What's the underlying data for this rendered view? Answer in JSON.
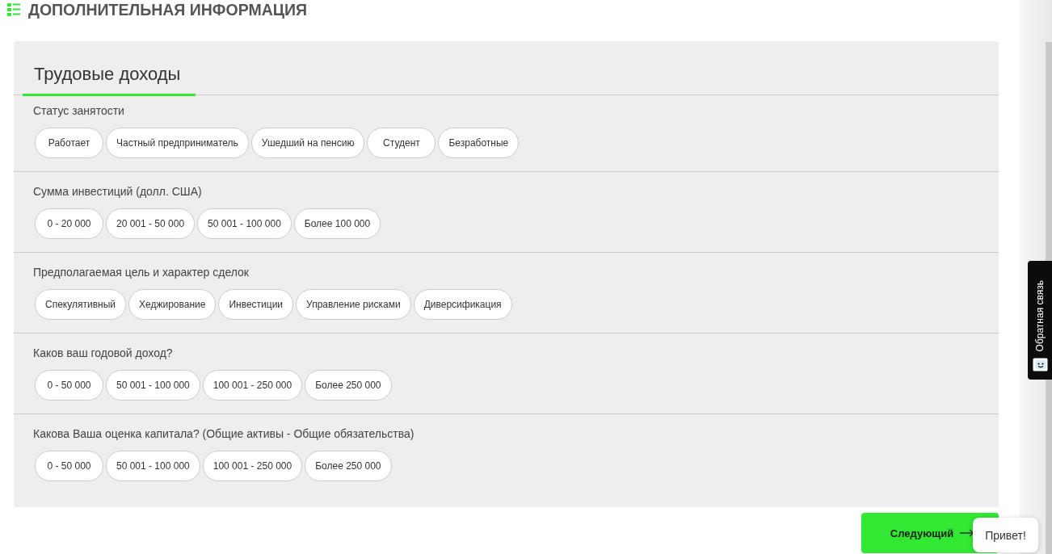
{
  "header": {
    "title": "ДОПОЛНИТЕЛЬНАЯ ИНФОРМАЦИЯ"
  },
  "tabs": [
    {
      "label": "Трудовые доходы",
      "selected": true
    }
  ],
  "questions": [
    {
      "label": "Статус занятости",
      "options": [
        {
          "label": "Работает",
          "selected": false
        },
        {
          "label": "Частный предприниматель",
          "selected": false
        },
        {
          "label": "Ушедший на пенсию",
          "selected": false
        },
        {
          "label": "Студент",
          "selected": false
        },
        {
          "label": "Безработные",
          "selected": false
        }
      ]
    },
    {
      "label": "Сумма инвестиций (долл. США)",
      "options": [
        {
          "label": "0 - 20 000",
          "selected": false
        },
        {
          "label": "20 001 - 50 000",
          "selected": false
        },
        {
          "label": "50 001 - 100 000",
          "selected": false
        },
        {
          "label": "Более 100 000",
          "selected": false
        }
      ]
    },
    {
      "label": "Предполагаемая цель и характер сделок",
      "options": [
        {
          "label": "Спекулятивный",
          "selected": false
        },
        {
          "label": "Хеджирование",
          "selected": false
        },
        {
          "label": "Инвестиции",
          "selected": false
        },
        {
          "label": "Управление рисками",
          "selected": false
        },
        {
          "label": "Диверсификация",
          "selected": false
        }
      ]
    },
    {
      "label": "Каков ваш годовой доход?",
      "options": [
        {
          "label": "0 - 50 000",
          "selected": false
        },
        {
          "label": "50 001 - 100 000",
          "selected": false
        },
        {
          "label": "100 001 - 250 000",
          "selected": false
        },
        {
          "label": "Более 250 000",
          "selected": false
        }
      ]
    },
    {
      "label": "Какова Ваша оценка капитала? (Общие активы - Общие обязательства)",
      "options": [
        {
          "label": "0 - 50 000",
          "selected": false
        },
        {
          "label": "50 001 - 100 000",
          "selected": false
        },
        {
          "label": "100 001 - 250 000",
          "selected": false
        },
        {
          "label": "Более 250 000",
          "selected": false
        }
      ]
    }
  ],
  "next_button": {
    "label": "Следующий"
  },
  "feedback_tab": {
    "label": "Обратная связь"
  },
  "chat_bubble": {
    "text": "Привет!"
  }
}
